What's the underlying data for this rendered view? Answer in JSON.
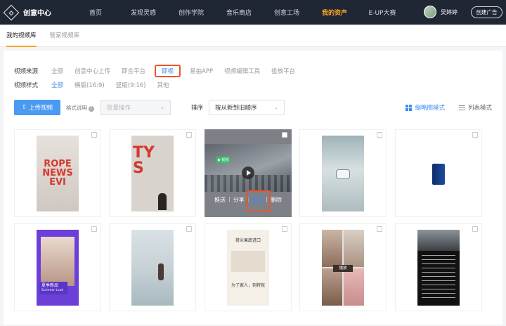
{
  "header": {
    "logo": "创意中心",
    "nav": [
      "首页",
      "发现灵感",
      "创作学院",
      "音乐商店",
      "创意工场",
      "我的资产",
      "E-UP大赛"
    ],
    "active_nav": "我的资产",
    "user_name": "吴婷婷",
    "create_ad": "创建广告"
  },
  "subtabs": [
    "我的视频库",
    "管家视频库"
  ],
  "filters": {
    "source_label": "视频来源",
    "sources": [
      "全部",
      "创意中心上传",
      "即合平台",
      "即视",
      "易拍APP",
      "视频编辑工具",
      "投放平台"
    ],
    "source_selected": "即视",
    "style_label": "视频样式",
    "styles": [
      "全部",
      "横版(16:9)",
      "竖版(9:16)",
      "其他"
    ],
    "style_selected": "全部"
  },
  "toolbar": {
    "upload": "上传视频",
    "format_hint": "格式说明",
    "batch": "批量操作",
    "sort_label": "排序",
    "sort_value": "按从新到旧顺序",
    "view_grid": "缩略图模式",
    "view_list": "列表模式"
  },
  "cards_row1": [
    {
      "name": "video-news"
    },
    {
      "name": "video-red-letters"
    },
    {
      "name": "video-building",
      "actions": [
        "推送",
        "分享",
        "编辑",
        "删除"
      ]
    },
    {
      "name": "video-robot"
    },
    {
      "name": "video-cosmetic"
    }
  ],
  "cards_row2": [
    {
      "name": "video-woman-summer",
      "caption": "夏季新品",
      "subcaption": "Summer Look"
    },
    {
      "name": "video-beach"
    },
    {
      "name": "video-text",
      "title": "荷兰果蔬进口",
      "caption": "为了家人，到将就"
    },
    {
      "name": "video-collage",
      "caption": "播放"
    },
    {
      "name": "video-city-text"
    }
  ],
  "colors": {
    "accent": "#f5a623",
    "link": "#3b8df0",
    "highlight": "#e8562a",
    "topbar": "#1f2634"
  }
}
